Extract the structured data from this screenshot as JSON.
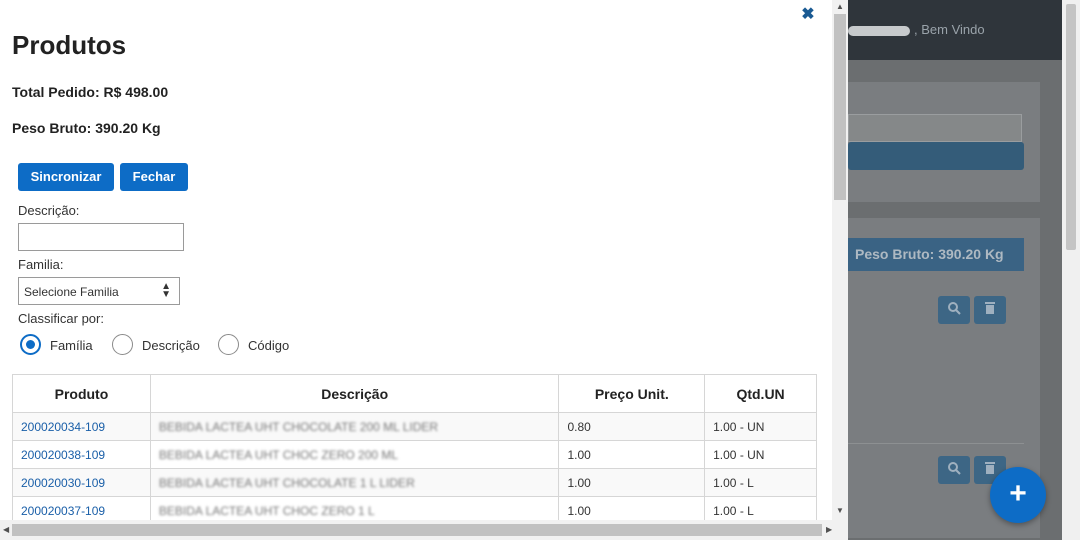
{
  "background": {
    "welcome_text": ", Bem Vindo",
    "peso_header": "Peso Bruto: 390.20 Kg"
  },
  "modal": {
    "title": "Produtos",
    "total_pedido": "Total Pedido: R$ 498.00",
    "peso_bruto": "Peso Bruto: 390.20 Kg",
    "buttons": {
      "sincronizar": "Sincronizar",
      "fechar": "Fechar"
    },
    "descricao_label": "Descrição:",
    "descricao_value": "",
    "familia_label": "Familia:",
    "familia_selected": "Selecione Familia",
    "classificar_label": "Classificar por:",
    "sort_options": [
      "Família",
      "Descrição",
      "Código"
    ],
    "sort_selected": "Família"
  },
  "table": {
    "headers": [
      "Produto",
      "Descrição",
      "Preço Unit.",
      "Qtd.UN"
    ],
    "rows": [
      {
        "produto": "200020034-109",
        "descricao": "BEBIDA LACTEA UHT CHOCOLATE 200 ML LIDER",
        "preco": "0.80",
        "qtd": "1.00 - UN"
      },
      {
        "produto": "200020038-109",
        "descricao": "BEBIDA LACTEA UHT CHOC ZERO 200 ML",
        "preco": "1.00",
        "qtd": "1.00 - UN"
      },
      {
        "produto": "200020030-109",
        "descricao": "BEBIDA LACTEA UHT CHOCOLATE 1 L LIDER",
        "preco": "1.00",
        "qtd": "1.00 - L"
      },
      {
        "produto": "200020037-109",
        "descricao": "BEBIDA LACTEA UHT CHOC ZERO 1 L",
        "preco": "1.00",
        "qtd": "1.00 - L"
      }
    ]
  },
  "icons": {
    "close": "close-icon",
    "search": "search-icon",
    "trash": "trash-icon",
    "add": "plus-icon"
  },
  "colors": {
    "primary": "#0d6cc6",
    "link": "#1a5fa8",
    "overlay_panel_header": "#3a6384"
  }
}
